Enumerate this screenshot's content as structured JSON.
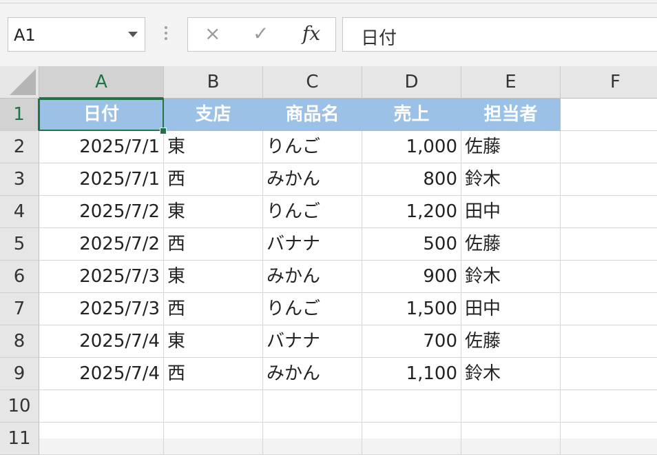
{
  "namebox": {
    "value": "A1"
  },
  "formula_bar": {
    "cancel_icon": "×",
    "enter_icon": "✓",
    "fx_label": "fx",
    "value": "日付"
  },
  "columns": [
    "A",
    "B",
    "C",
    "D",
    "E",
    "F"
  ],
  "rows": [
    "1",
    "2",
    "3",
    "4",
    "5",
    "6",
    "7",
    "8",
    "9",
    "10",
    "11"
  ],
  "header": [
    "日付",
    "支店",
    "商品名",
    "売上",
    "担当者"
  ],
  "data": [
    [
      "2025/7/1",
      "東",
      "りんご",
      "1,000",
      "佐藤"
    ],
    [
      "2025/7/1",
      "西",
      "みかん",
      "800",
      "鈴木"
    ],
    [
      "2025/7/2",
      "東",
      "りんご",
      "1,200",
      "田中"
    ],
    [
      "2025/7/2",
      "西",
      "バナナ",
      "500",
      "佐藤"
    ],
    [
      "2025/7/3",
      "東",
      "みかん",
      "900",
      "鈴木"
    ],
    [
      "2025/7/3",
      "西",
      "りんご",
      "1,500",
      "田中"
    ],
    [
      "2025/7/4",
      "東",
      "バナナ",
      "700",
      "佐藤"
    ],
    [
      "2025/7/4",
      "西",
      "みかん",
      "1,100",
      "鈴木"
    ]
  ],
  "colors": {
    "header_fill": "#9bc2e6",
    "selection": "#217346"
  }
}
